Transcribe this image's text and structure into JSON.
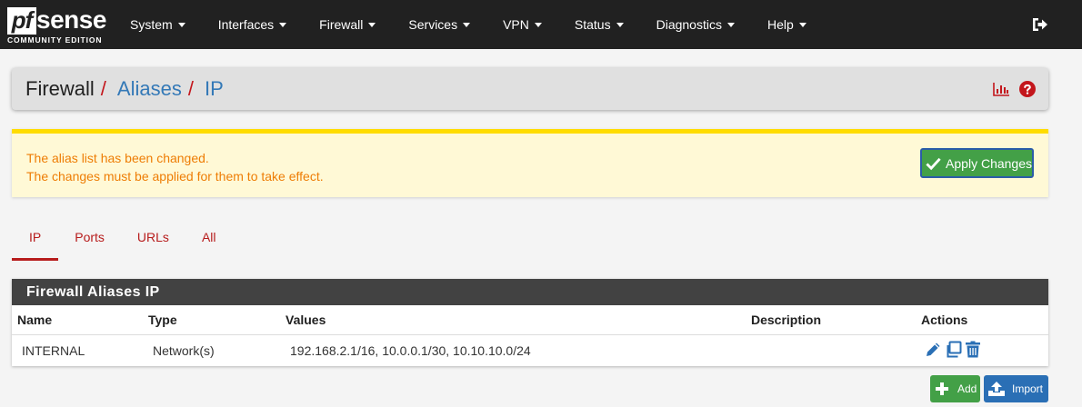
{
  "brand": {
    "name": "pfsense",
    "edition": "COMMUNITY EDITION"
  },
  "nav": {
    "menus": [
      "System",
      "Interfaces",
      "Firewall",
      "Services",
      "VPN",
      "Status",
      "Diagnostics",
      "Help"
    ],
    "logout_icon": "sign-out-icon"
  },
  "breadcrumb": {
    "items": [
      "Firewall",
      "Aliases",
      "IP"
    ],
    "icons": [
      "chart-bar-icon",
      "question-circle-icon"
    ]
  },
  "notice": {
    "line1": "The alias list has been changed.",
    "line2": "The changes must be applied for them to take effect.",
    "apply_label": "Apply Changes"
  },
  "tabs": {
    "items": [
      "IP",
      "Ports",
      "URLs",
      "All"
    ],
    "active": "IP"
  },
  "table": {
    "title": "Firewall Aliases IP",
    "columns": [
      "Name",
      "Type",
      "Values",
      "Description",
      "Actions"
    ],
    "rows": [
      {
        "name": "INTERNAL",
        "type": "Network(s)",
        "values": "192.168.2.1/16, 10.0.0.1/30, 10.10.10.0/24",
        "description": ""
      }
    ]
  },
  "buttons": {
    "add": "Add",
    "import": "Import"
  },
  "colors": {
    "navbar": "#212121",
    "brand_red": "#b71c1c",
    "link_blue": "#3479b7",
    "success_green": "#43a047",
    "warning_orange": "#ee7d05",
    "warning_bg": "#fff9d6",
    "action_blue": "#2a6fb5"
  }
}
